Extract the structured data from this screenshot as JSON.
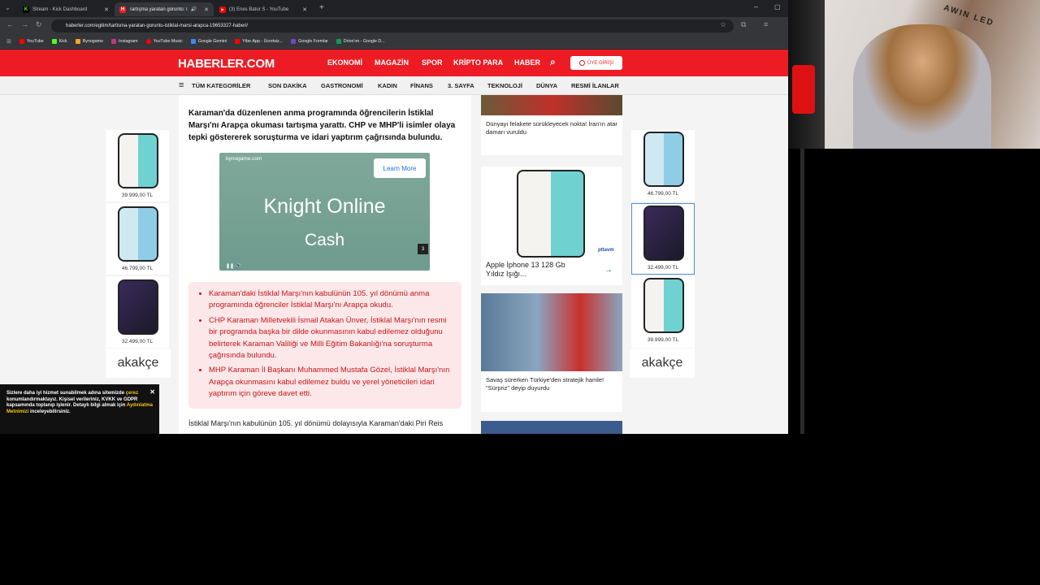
{
  "browser": {
    "tabs": [
      {
        "title": "Stream - Kick Dashboard",
        "favicon": "K",
        "color": "#53fc18",
        "active": false
      },
      {
        "title": "Tartışma yaratan görüntü: İ",
        "favicon": "H",
        "color": "#ed1c24",
        "active": true
      },
      {
        "title": "(3) Enes Batur S - YouTube",
        "favicon": "▶",
        "color": "#ff0000",
        "active": false
      }
    ],
    "url": "haberler.com/egitim/tartisma-yaratan-goruntu-istiklal-marsi-arapca-19653327-haberi/",
    "bookmarks": [
      "YouTube",
      "Kick",
      "Bynogame",
      "Instagram",
      "YouTube Music",
      "Google Gemini",
      "Ytbe.App - Ücretsiz...",
      "Google Formlar",
      "Drive'ım - Google D..."
    ]
  },
  "site": {
    "logo": "HABERLER.COM",
    "main_nav": [
      "EKONOMİ",
      "MAGAZİN",
      "SPOR",
      "KRİPTO PARA",
      "HABER"
    ],
    "login": "ÜYE GİRİŞİ",
    "categories": [
      "TÜM KATEGORİLER",
      "SON DAKİKA",
      "GASTRONOMİ",
      "KADIN",
      "FİNANS",
      "3. SAYFA",
      "TEKNOLOJİ",
      "DÜNYA",
      "RESMİ İLANLAR"
    ]
  },
  "article": {
    "lead": "Karaman'da düzenlenen anma programında öğrencilerin İstiklal Marşı'nı Arapça okuması tartışma yarattı. CHP ve MHP'li isimler olaya tepki göstererek soruşturma ve idari yaptırım çağrısında bulundu.",
    "video": {
      "domain": "bynogame.com",
      "cta": "Learn More",
      "line1": "Knight Online",
      "line2": "Cash",
      "count": "3"
    },
    "summary": [
      "Karaman'daki İstiklal Marşı'nın kabulünün 105. yıl dönümü anma programında öğrenciler İstiklal Marşı'nı Arapça okudu.",
      "CHP Karaman Milletvekili İsmail Atakan Ünver, İstiklal Marşı'nın resmi bir programda başka bir dilde okunmasının kabul edilemez olduğunu belirterek Karaman Valiliği ve Milli Eğitim Bakanlığı'na soruşturma çağrısında bulundu.",
      "MHP Karaman İl Başkanı Muhammed Mustafa Gözel, İstiklal Marşı'nın Arapça okunmasını kabul edilemez buldu ve yerel yöneticileri idari yaptırım için göreve davet etti."
    ],
    "body_start": "İstiklal Marşı'nın kabulünün 105. yıl dönümü dolayısıyla Karaman'daki Piri Reis"
  },
  "sidebar": {
    "news1": "Dünyayı felakete sürükleyecek nokta! İran'ın atar damarı vuruldu",
    "ad_product": "Apple İphone 13 128 Gb Yıldız Işığı...",
    "ad_brand": "pttavm",
    "news2": "Savaş sürerken Türkiye'den stratejik hamle! \"Sürpriz\" deyip duyurdu"
  },
  "left_ads": {
    "prices": [
      "39.999,00 TL",
      "46.799,00 TL",
      "32.499,00 TL"
    ],
    "brand": "akakçe"
  },
  "right_ads": {
    "prices": [
      "46.799,00 TL",
      "32.499,00 TL",
      "39.999,00 TL"
    ],
    "brand": "akakçe"
  },
  "cookie": {
    "text1": "Sizlere daha iyi hizmet sunabilmek adına sitemizde",
    "link1": "çerez",
    "text2": "konumlandırmaktayız. Kişisel verileriniz, KVKK ve GDPR kapsamında toplanıp işlenir. Detaylı bilgi almak için",
    "link2": "Aydınlatma Metnimizi",
    "text3": "inceleyebilirsiniz."
  },
  "webcam": {
    "neon": "AWIN LED"
  }
}
